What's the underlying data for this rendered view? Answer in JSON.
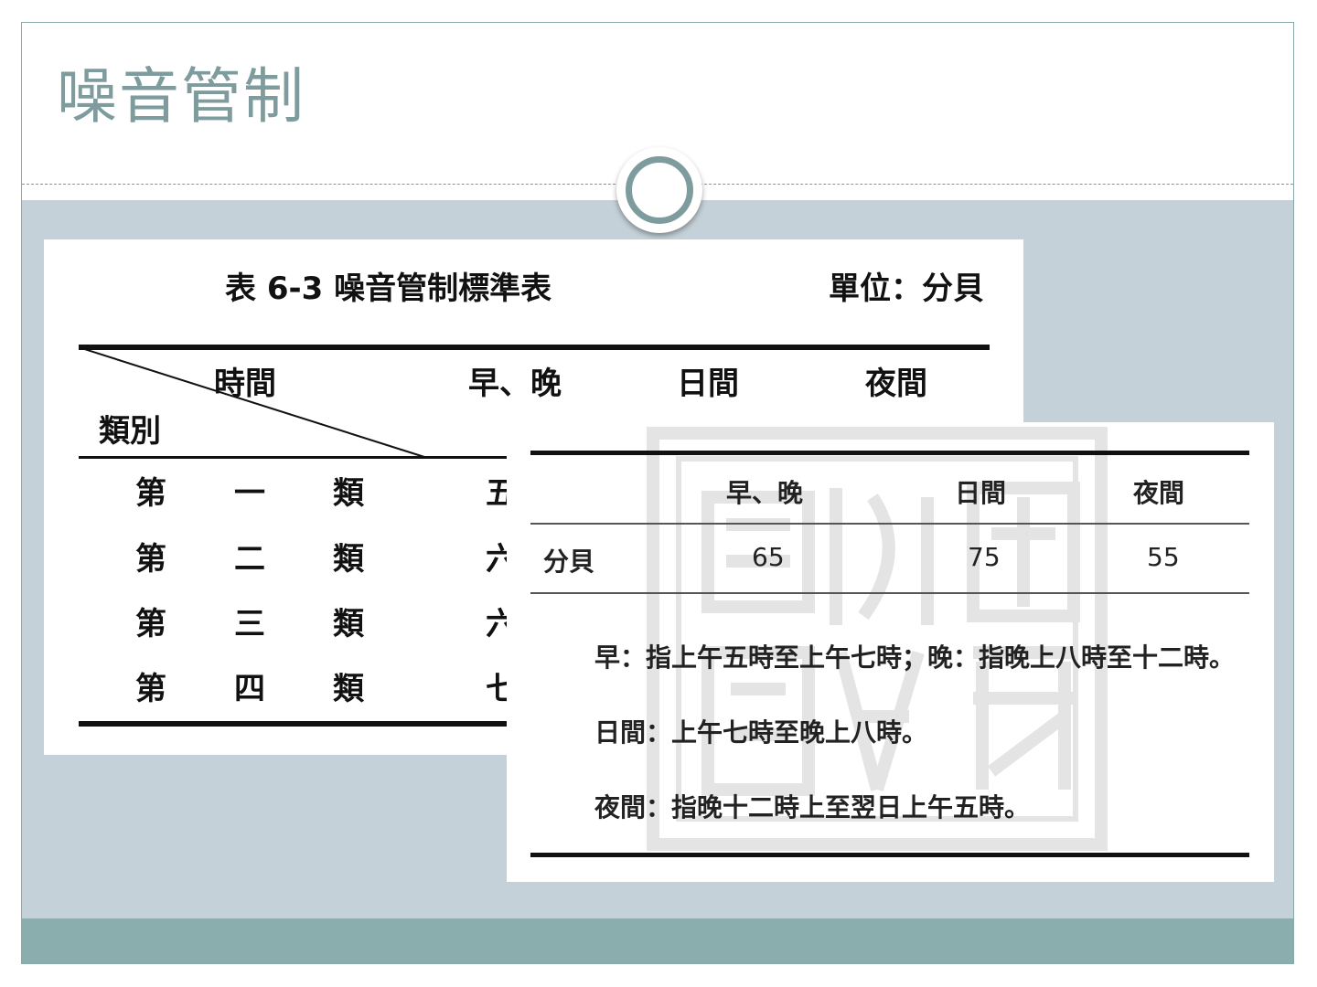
{
  "slide": {
    "title": "噪音管制"
  },
  "table_left": {
    "title": "表 6-3 噪音管制標準表",
    "unit": "單位：分貝",
    "header_time": "時間",
    "header_category": "類別",
    "columns": [
      "早、晚",
      "日間",
      "夜間"
    ],
    "rows": [
      {
        "cells": [
          "第",
          "一",
          "類"
        ],
        "first_value": "五"
      },
      {
        "cells": [
          "第",
          "二",
          "類"
        ],
        "first_value": "六"
      },
      {
        "cells": [
          "第",
          "三",
          "類"
        ],
        "first_value": "六"
      },
      {
        "cells": [
          "第",
          "四",
          "類"
        ],
        "first_value": "七"
      }
    ]
  },
  "table_right": {
    "columns": [
      "早、晚",
      "日間",
      "夜間"
    ],
    "row_label": "分貝",
    "values": [
      "65",
      "75",
      "55"
    ],
    "notes": [
      "早：指上午五時至上午七時；晚：指晚上八時至十二時。",
      "日間：上午七時至晚上八時。",
      "夜間：指晚十二時上至翌日上午五時。"
    ]
  },
  "colors": {
    "accent": "#7e9c9d",
    "content_bg": "#c4d1d8",
    "footer": "#8aadad"
  }
}
